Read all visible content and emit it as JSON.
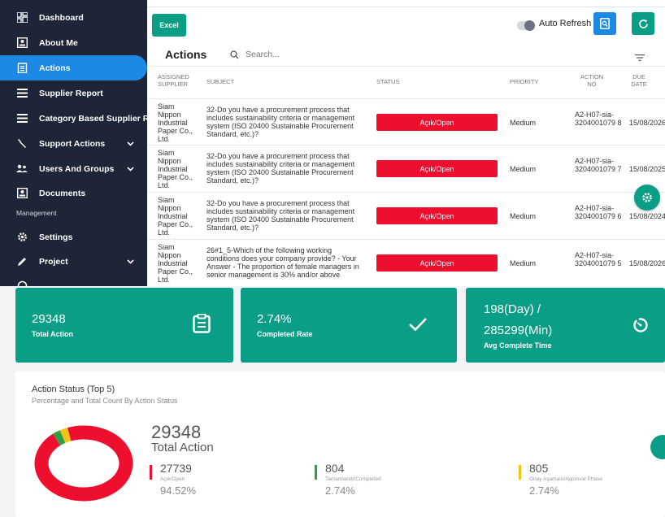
{
  "sidebar": {
    "items": [
      {
        "label": "Dashboard",
        "icon": "dashboard-icon"
      },
      {
        "label": "About Me",
        "icon": "id-card-icon"
      },
      {
        "label": "Actions",
        "icon": "clipboard-icon",
        "active": true
      },
      {
        "label": "Supplier Report",
        "icon": "list-icon"
      },
      {
        "label": "Category Based Supplier Report",
        "icon": "list-icon"
      },
      {
        "label": "Support Actions",
        "icon": "tools-icon"
      },
      {
        "label": "Users And Groups",
        "icon": "users-icon"
      },
      {
        "label": "Documents",
        "icon": "document-icon"
      },
      {
        "label": "Settings",
        "icon": "gear-icon"
      },
      {
        "label": "Project",
        "icon": "pencil-icon"
      }
    ],
    "section_management": "Management"
  },
  "toolbar": {
    "excel_label": "Excel",
    "auto_refresh_label": "Auto Refresh"
  },
  "actions": {
    "title": "Actions",
    "search_placeholder": "Search..."
  },
  "table": {
    "headers": {
      "supplier": "ASSIGNED SUPPLIER",
      "subject": "SUBJECT",
      "status": "STATUS",
      "priority": "PRIORITY",
      "action_no": "ACTION NO",
      "due_date": "DUE DATE"
    },
    "rows": [
      {
        "supplier": "Siam Nippon Industrial Paper Co., Ltd.",
        "subject": "32-Do you have a procurement process that includes sustainability criteria or management system (ISO 20400 Sustainable Procurement Standard, etc.)?",
        "status": "Açık/Open",
        "priority": "Medium",
        "action_no": "A2-H07-sia-3204001079 8",
        "due_date": "15/08/2026"
      },
      {
        "supplier": "Siam Nippon Industrial Paper Co., Ltd.",
        "subject": "32-Do you have a procurement process that includes sustainability criteria or management system (ISO 20400 Sustainable Procurement Standard, etc.)?",
        "status": "Açık/Open",
        "priority": "Medium",
        "action_no": "A2-H07-sia-3204001079 7",
        "due_date": "15/08/2025"
      },
      {
        "supplier": "Siam Nippon Industrial Paper Co., Ltd.",
        "subject": "32-Do you have a procurement process that includes sustainability criteria or management system (ISO 20400 Sustainable Procurement Standard, etc.)?",
        "status": "Açık/Open",
        "priority": "Medium",
        "action_no": "A2-H07-sia-3204001079 6",
        "due_date": "15/08/2024"
      },
      {
        "supplier": "Siam Nippon Industrial Paper Co., Ltd.",
        "subject": "26#1_5-Which of the following working conditions does your company provide? - Your Answer - The proportion of female managers in senior management is 30% and/or above",
        "status": "Açık/Open",
        "priority": "Medium",
        "action_no": "A2-H07-sia-3204001079 5",
        "due_date": "15/08/2026"
      }
    ]
  },
  "cards": {
    "total": {
      "value": "29348",
      "label": "Total Action"
    },
    "rate": {
      "value": "2.74%",
      "label": "Completed Rate"
    },
    "time": {
      "line1": "198(Day) /",
      "line2": "285299(Min)",
      "label": "Avg Complete Time"
    }
  },
  "status_panel": {
    "title": "Action Status (Top 5)",
    "subtitle": "Percentage and Total Count By Action Status",
    "total_value": "29348",
    "total_label": "Total Action",
    "stats": [
      {
        "count": "27739",
        "label": "Açık/Open",
        "percent": "94.52%",
        "color": "#ee0e2e",
        "fraction": 0.9452
      },
      {
        "count": "804",
        "label": "Tamamlandı/Completed",
        "percent": "2.74%",
        "color": "#2ea043",
        "fraction": 0.0274
      },
      {
        "count": "805",
        "label": "Onay Aşaması/Approval Phase",
        "percent": "2.74%",
        "color": "#f2c21b",
        "fraction": 0.0274
      }
    ]
  },
  "colors": {
    "sidebar_bg": "#1e2536",
    "active_blue": "#1e88e5",
    "teal": "#0b9e86",
    "open_red": "#ee0e2e"
  }
}
